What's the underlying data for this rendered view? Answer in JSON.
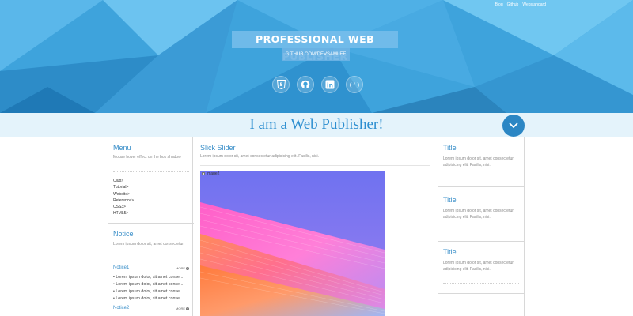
{
  "header": {
    "top_links": [
      "Blog",
      "Github",
      "Webstandard"
    ],
    "title": "PROFESSIONAL WEB PUBLISHER",
    "subtitle": "GITHUB.COM/DEVSAMLEE",
    "social_icons": [
      "html5-icon",
      "github-icon",
      "linkedin-icon",
      "freecodecamp-icon"
    ]
  },
  "banner": {
    "text": "I am a Web Publisher!",
    "button_icon": "chevron-down-icon"
  },
  "left": {
    "menu_title": "Menu",
    "menu_desc": "Mouse hover effect on the box shadow",
    "menu_items": [
      "Club>",
      "Tutorial>",
      "Website>",
      "Reference>",
      "CSS3>",
      "HTML5>"
    ],
    "notice_title": "Notice",
    "notice_desc": "Lorem ipsum dolor sit, amet consectetur.",
    "notice1_label": "Notice1",
    "notice2_label": "Notice2",
    "more_label": "MORE",
    "notice_items": [
      "• Lorem ipsum dolor, sit amet conse...",
      "• Lorem ipsum dolor, sit amet conse...",
      "• Lorem ipsum dolor, sit amet conse...",
      "• Lorem ipsum dolor, sit amet conse..."
    ]
  },
  "main": {
    "title": "Slick Slider",
    "desc": "Lorem ipsum dolor sit, amet consectetur adipisicing elit. Facilis, nisi.",
    "slide_alt": "image2"
  },
  "right": {
    "blocks": [
      {
        "title": "Title",
        "desc": "Lorem ipsum dolor sit, amet consectetur adipisicing elit. Facilis, nisi."
      },
      {
        "title": "Title",
        "desc": "Lorem ipsum dolor sit, amet consectetur adipisicing elit. Facilis, nisi."
      },
      {
        "title": "Title",
        "desc": "Lorem ipsum dolor sit, amet consectetur adipisicing elit. Facilis, nisi."
      }
    ]
  },
  "colors": {
    "accent": "#3a8fc9",
    "header_blue": "#3ea3dc",
    "banner_bg": "#e4f3fb",
    "button_blue": "#2b86c4"
  }
}
